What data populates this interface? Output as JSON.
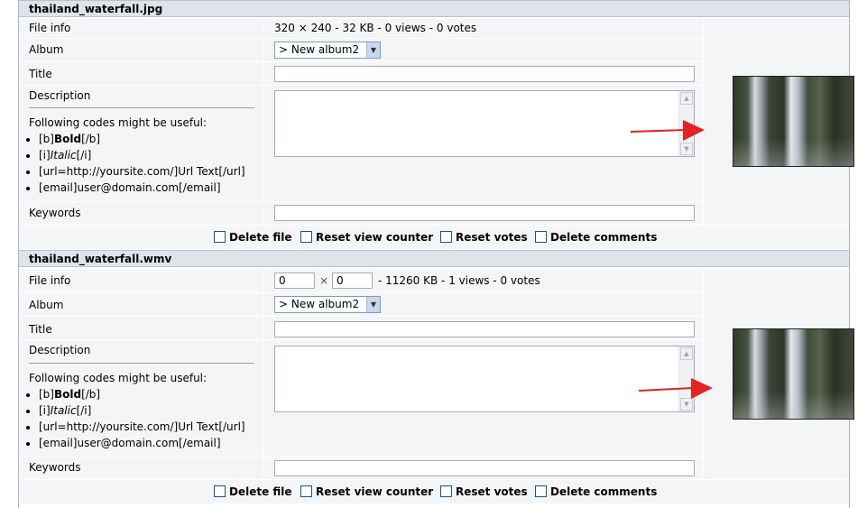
{
  "files": [
    {
      "filename": "thailand_waterfall.jpg",
      "labels": {
        "file_info": "File info",
        "album": "Album",
        "title": "Title",
        "description": "Description",
        "keywords": "Keywords"
      },
      "file_info": "320 × 240 - 32 KB - 0 views - 0 votes",
      "album_selected": "> New album2",
      "title_value": "",
      "description_value": "",
      "keywords_value": "",
      "codes_heading": "Following codes might be useful:",
      "codes": {
        "bold_open": "[b]",
        "bold_text": "Bold",
        "bold_close": "[/b]",
        "italic_open": "[i]",
        "italic_text": "Italic",
        "italic_close": "[/i]",
        "url": "[url=http://yoursite.com/]Url Text[/url]",
        "email": "[email]user@domain.com[/email]"
      },
      "actions": {
        "delete_file": "Delete file",
        "reset_view_counter": "Reset view counter",
        "reset_votes": "Reset votes",
        "delete_comments": "Delete comments"
      }
    },
    {
      "filename": "thailand_waterfall.wmv",
      "labels": {
        "file_info": "File info",
        "album": "Album",
        "title": "Title",
        "description": "Description",
        "keywords": "Keywords"
      },
      "width_value": "0",
      "times": "×",
      "height_value": "0",
      "file_info_rest": "- 11260 KB - 1 views - 0 votes",
      "album_selected": "> New album2",
      "title_value": "",
      "description_value": "",
      "keywords_value": "",
      "codes_heading": "Following codes might be useful:",
      "codes": {
        "bold_open": "[b]",
        "bold_text": "Bold",
        "bold_close": "[/b]",
        "italic_open": "[i]",
        "italic_text": "Italic",
        "italic_close": "[/i]",
        "url": "[url=http://yoursite.com/]Url Text[/url]",
        "email": "[email]user@domain.com[/email]"
      },
      "actions": {
        "delete_file": "Delete file",
        "reset_view_counter": "Reset view counter",
        "reset_votes": "Reset votes",
        "delete_comments": "Delete comments"
      }
    }
  ],
  "colors": {
    "header_bg": "#dfe3ea",
    "cell_bg": "#f4f5f7",
    "annotation_arrow": "#e32222"
  },
  "icons": {
    "annotation": "red-arrow-icon",
    "select": "chevron-down-icon"
  }
}
